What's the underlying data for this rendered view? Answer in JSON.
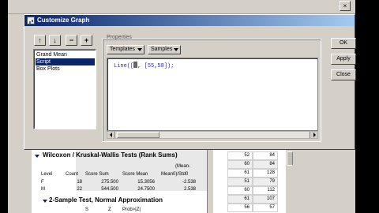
{
  "dialog": {
    "title": "Customize Graph",
    "toolbar": {
      "up_glyph": "↑",
      "down_glyph": "↓",
      "minus_glyph": "−",
      "plus_glyph": "+"
    },
    "list": [
      "Grand Mean",
      "Script",
      "Box Plots"
    ],
    "selected_index": 1,
    "properties_label": "Properties",
    "templates_label": "Templates",
    "samples_label": "Samples",
    "code_prefix": "Line([",
    "code_suffix": ", [55,58]);",
    "buttons": {
      "ok": "OK",
      "apply": "Apply",
      "close": "Close"
    }
  },
  "report": {
    "section1_title": "Wilcoxon / Kruskal-Wallis Tests (Rank Sums)",
    "headers": [
      "Level",
      "Count",
      "Score Sum",
      "Score Mean",
      "(Mean-",
      "Mean0)/Std0"
    ],
    "rows": [
      [
        "F",
        "18",
        "275.500",
        "15.3056",
        "-2.538"
      ],
      [
        "M",
        "22",
        "544.500",
        "24.7500",
        "2.538"
      ]
    ],
    "section2_title": "2-Sample Test, Normal Approximation",
    "section2_headers": [
      "S",
      "Z",
      "Prob>|Z|"
    ]
  },
  "grid": {
    "col1": [
      "52",
      "60",
      "61",
      "51",
      "60",
      "61",
      "56"
    ],
    "col2": [
      "84",
      "84",
      "128",
      "79",
      "112",
      "107",
      "57"
    ]
  }
}
